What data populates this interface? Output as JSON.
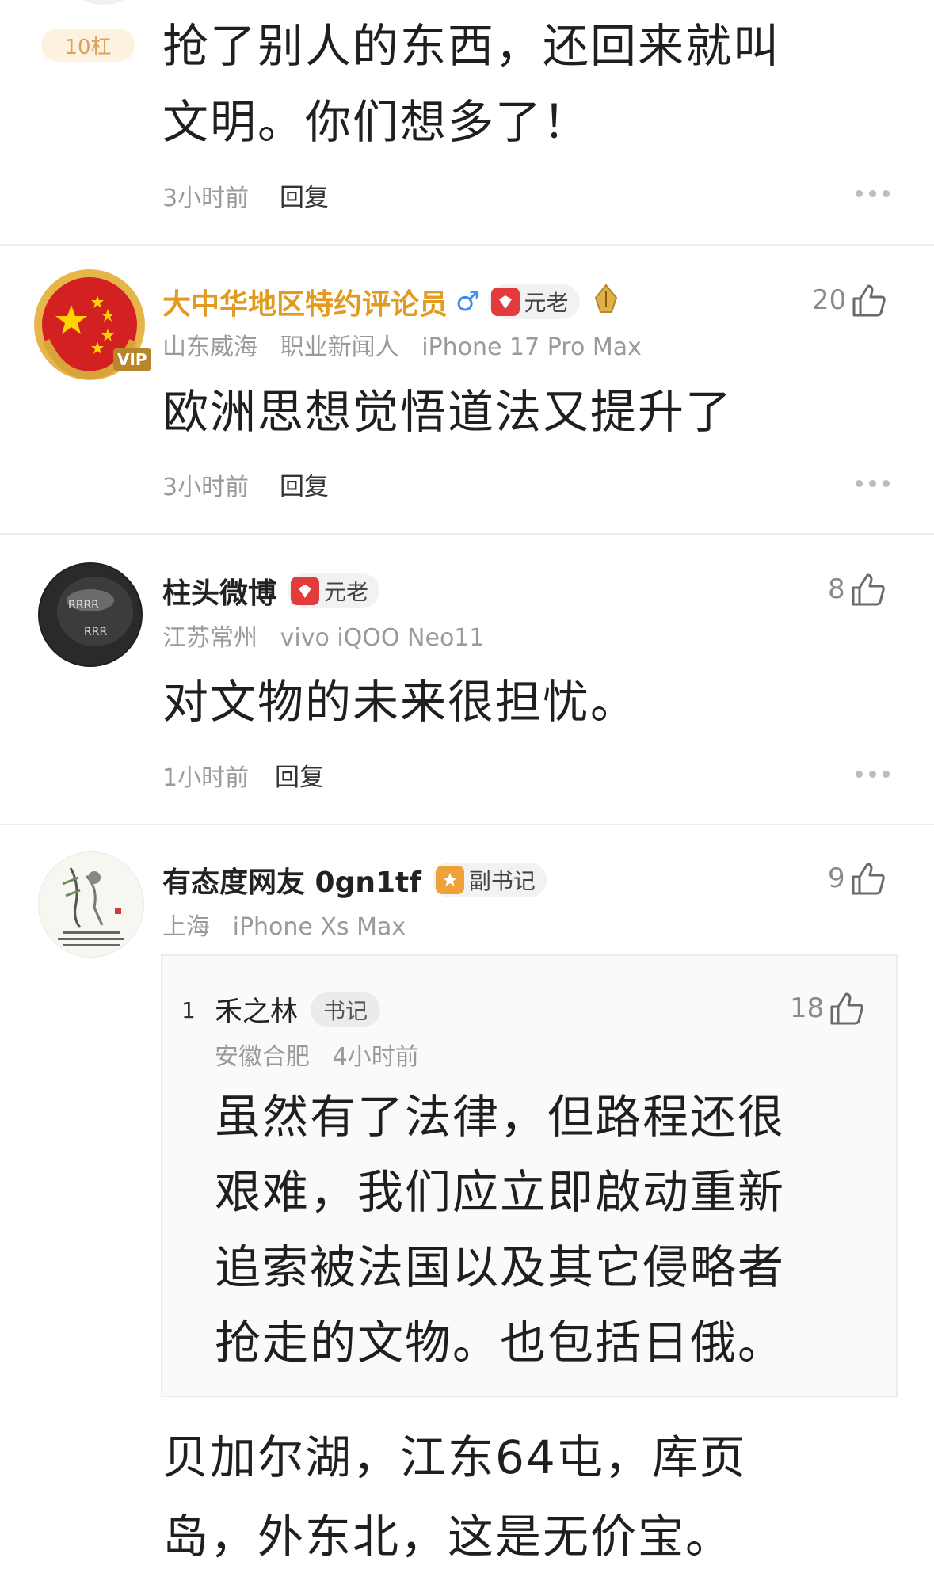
{
  "comments": [
    {
      "rank_tag": "10杠",
      "text_lines": [
        "抢了别人的东西，还回来就叫",
        "文明。你们想多了！"
      ],
      "time": "3小时前",
      "reply_label": "回复"
    },
    {
      "name": "大中华地区特约评论员",
      "gender_icon": "♂",
      "badge": "元老",
      "likes": "20",
      "location": "山东威海",
      "title": "职业新闻人",
      "device": "iPhone 17 Pro Max",
      "text_lines": [
        "欧洲思想觉悟道法又提升了"
      ],
      "time": "3小时前",
      "reply_label": "回复",
      "vip_label": "VIP"
    },
    {
      "name": "柱头微博",
      "badge": "元老",
      "likes": "8",
      "location": "江苏常州",
      "device": "vivo iQOO Neo11",
      "text_lines": [
        "对文物的未来很担忧。"
      ],
      "time": "1小时前",
      "reply_label": "回复"
    },
    {
      "name": "有态度网友 0gn1tf",
      "badge": "副书记",
      "likes": "9",
      "location": "上海",
      "device": "iPhone Xs Max",
      "quote": {
        "floor": "1",
        "name": "禾之林",
        "badge": "书记",
        "likes": "18",
        "location": "安徽合肥",
        "time": "4小时前",
        "text_lines": [
          "虽然有了法律，但路程还很",
          "艰难，我们应立即啟动重新",
          "追索被法国以及其它侵略者",
          "抢走的文物。也包括日俄。"
        ]
      },
      "text_lines": [
        "贝加尔湖，江东64屯，库页",
        "岛，外东北，这是无价宝。"
      ]
    }
  ],
  "colors": {
    "gold_name": "#e29a1f",
    "badge_red": "#e23b3b",
    "badge_orange": "#f0a23a"
  }
}
